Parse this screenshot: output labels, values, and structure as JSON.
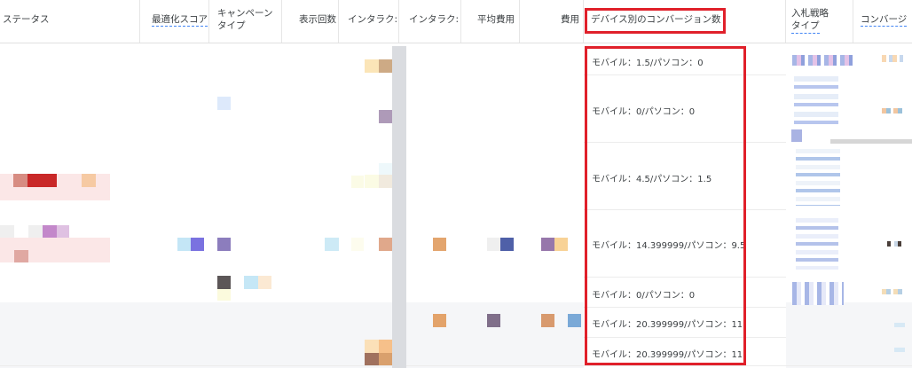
{
  "header": {
    "status": "ステータス",
    "optimization_score": "最適化スコア",
    "campaign_type_line1": "キャンペーン",
    "campaign_type_line2": "タイプ",
    "impressions": "表示回数",
    "interactions1": "インタラク:",
    "interactions2": "インタラク:",
    "avg_cost": "平均費用",
    "cost": "費用",
    "conversions_by_device": "デバイス別のコンバージョン数",
    "bid_strategy_line1": "入札戦略",
    "bid_strategy_line2": "タイプ",
    "conversions": "コンバージ"
  },
  "device_conversions": [
    "モバイル：1.5/パソコン：0",
    "モバイル：0/パソコン：0",
    "モバイル：4.5/パソコン：1.5",
    "モバイル：14.399999/パソコン：9.5",
    "モバイル：0/パソコン：0",
    "モバイル：20.399999/パソコン：11",
    "モバイル：20.399999/パソコン：11"
  ],
  "colors": {
    "highlight": "#e0202a",
    "link_underline": "#4285f4",
    "row_band": "#f5f6f8",
    "scrollbar": "#dadce0"
  }
}
